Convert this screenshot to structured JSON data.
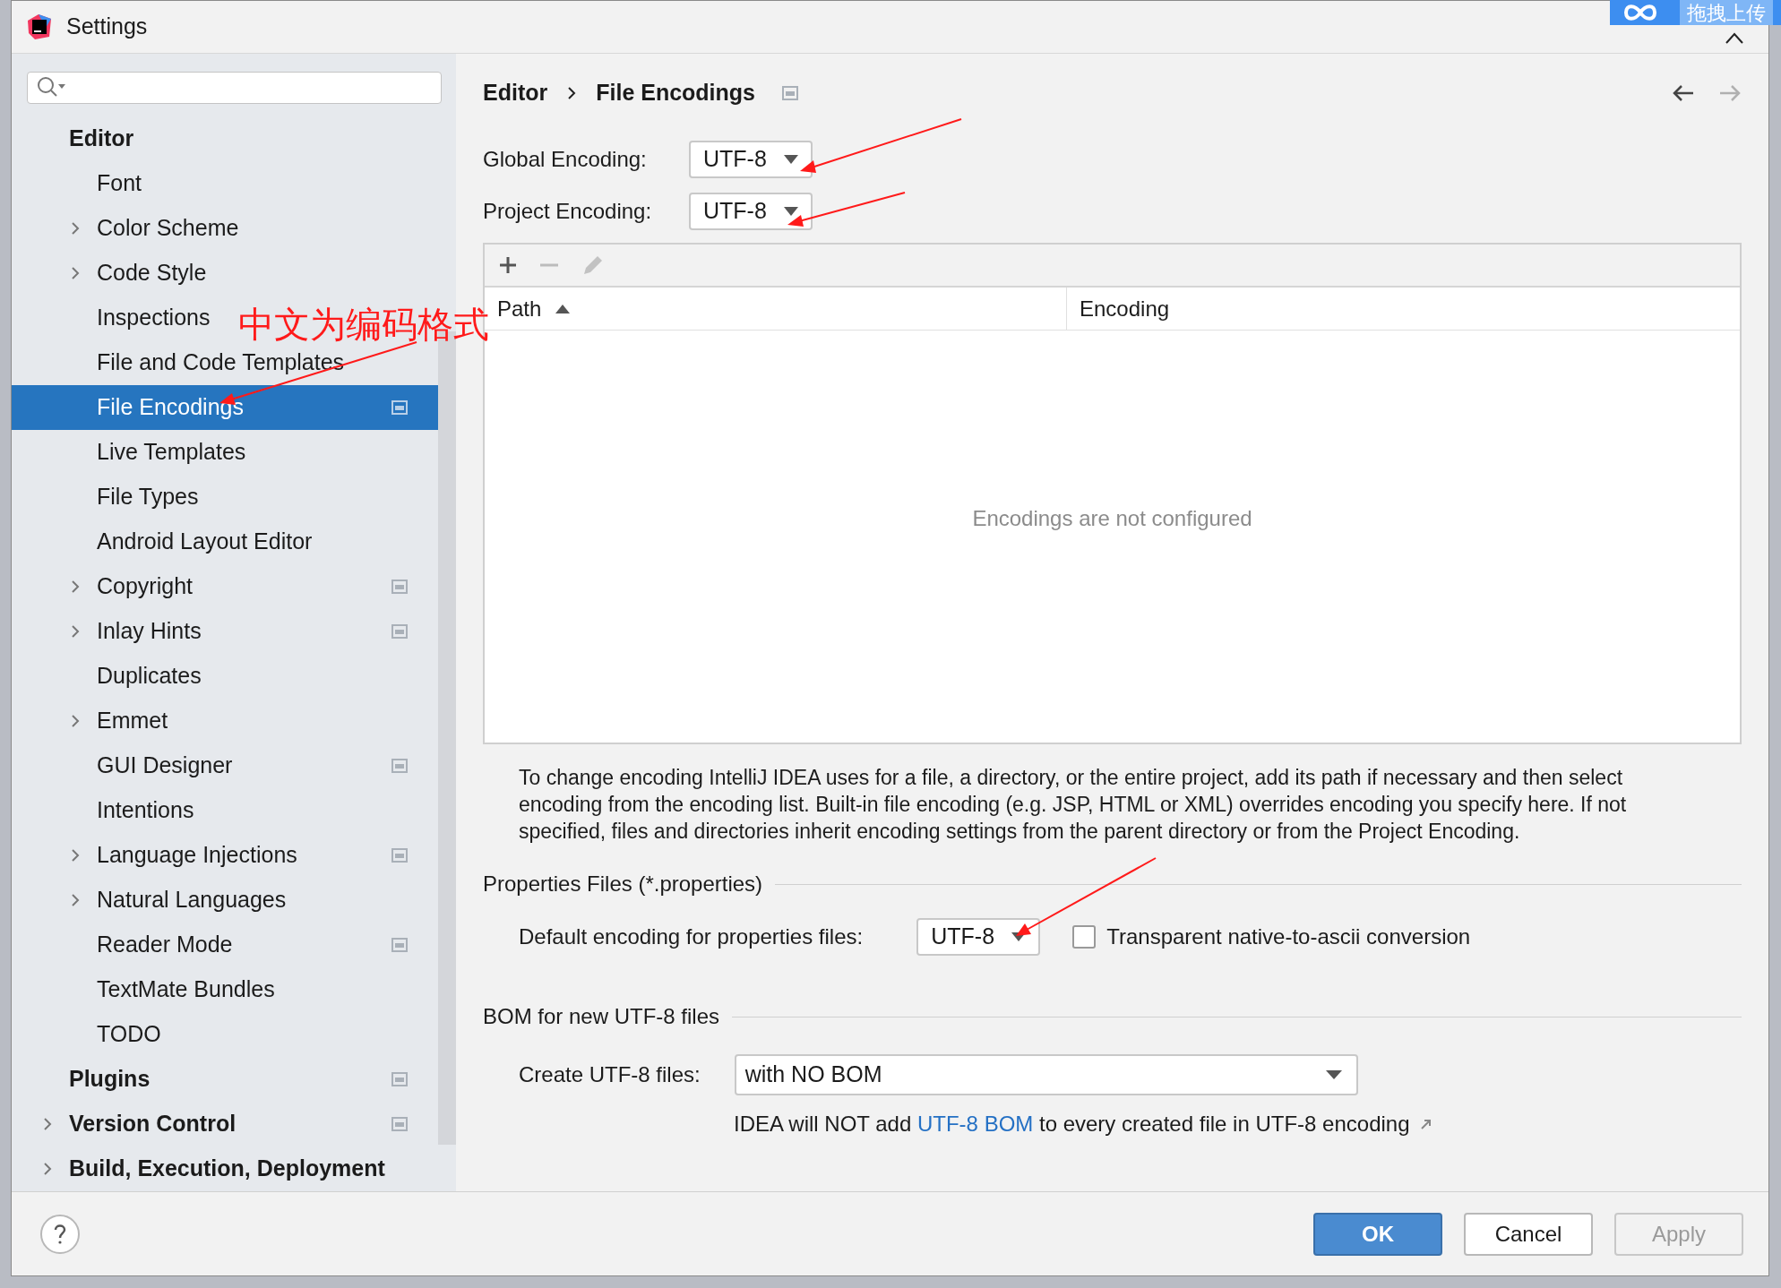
{
  "window": {
    "title": "Settings"
  },
  "upload_tab": {
    "label": "拖拽上传"
  },
  "tree": [
    {
      "label": "Editor",
      "collapsed": false,
      "selected": false,
      "project_icon": false,
      "children": [
        {
          "label": "Font",
          "collapsed": false,
          "selected": false,
          "project_icon": false
        },
        {
          "label": "Color Scheme",
          "collapsed": true,
          "selected": false,
          "project_icon": false
        },
        {
          "label": "Code Style",
          "collapsed": true,
          "selected": false,
          "project_icon": false
        },
        {
          "label": "Inspections",
          "collapsed": false,
          "selected": false,
          "project_icon": false
        },
        {
          "label": "File and Code Templates",
          "collapsed": false,
          "selected": false,
          "project_icon": false
        },
        {
          "label": "File Encodings",
          "collapsed": false,
          "selected": true,
          "project_icon": true
        },
        {
          "label": "Live Templates",
          "collapsed": false,
          "selected": false,
          "project_icon": false
        },
        {
          "label": "File Types",
          "collapsed": false,
          "selected": false,
          "project_icon": false
        },
        {
          "label": "Android Layout Editor",
          "collapsed": false,
          "selected": false,
          "project_icon": false
        },
        {
          "label": "Copyright",
          "collapsed": true,
          "selected": false,
          "project_icon": true
        },
        {
          "label": "Inlay Hints",
          "collapsed": true,
          "selected": false,
          "project_icon": true
        },
        {
          "label": "Duplicates",
          "collapsed": false,
          "selected": false,
          "project_icon": false
        },
        {
          "label": "Emmet",
          "collapsed": true,
          "selected": false,
          "project_icon": false
        },
        {
          "label": "GUI Designer",
          "collapsed": false,
          "selected": false,
          "project_icon": true
        },
        {
          "label": "Intentions",
          "collapsed": false,
          "selected": false,
          "project_icon": false
        },
        {
          "label": "Language Injections",
          "collapsed": true,
          "selected": false,
          "project_icon": true
        },
        {
          "label": "Natural Languages",
          "collapsed": true,
          "selected": false,
          "project_icon": false
        },
        {
          "label": "Reader Mode",
          "collapsed": false,
          "selected": false,
          "project_icon": true
        },
        {
          "label": "TextMate Bundles",
          "collapsed": false,
          "selected": false,
          "project_icon": false
        },
        {
          "label": "TODO",
          "collapsed": false,
          "selected": false,
          "project_icon": false
        }
      ]
    },
    {
      "label": "Plugins",
      "collapsed": false,
      "selected": false,
      "project_icon": true
    },
    {
      "label": "Version Control",
      "collapsed": true,
      "selected": false,
      "project_icon": true
    },
    {
      "label": "Build, Execution, Deployment",
      "collapsed": true,
      "selected": false,
      "project_icon": false
    }
  ],
  "breadcrumb": [
    "Editor",
    "File Encodings"
  ],
  "global_encoding": {
    "label": "Global Encoding:",
    "value": "UTF-8"
  },
  "project_encoding": {
    "label": "Project Encoding:",
    "value": "UTF-8"
  },
  "table": {
    "columns": [
      {
        "label": "Path",
        "sorted": true
      },
      {
        "label": "Encoding",
        "sorted": false
      }
    ],
    "empty_text": "Encodings are not configured"
  },
  "description": "To change encoding IntelliJ IDEA uses for a file, a directory, or the entire project, add its path if necessary and then select encoding from the encoding list. Built-in file encoding (e.g. JSP, HTML or XML) overrides encoding you specify here. If not specified, files and directories inherit encoding settings from the parent directory or from the Project Encoding.",
  "properties": {
    "title": "Properties Files (*.properties)",
    "label": "Default encoding for properties files:",
    "value": "UTF-8",
    "checkbox": {
      "label": "Transparent native-to-ascii conversion",
      "checked": false
    }
  },
  "bom": {
    "title": "BOM for new UTF-8 files",
    "label": "Create UTF-8 files:",
    "value": "with NO BOM",
    "note_before": "IDEA will NOT add",
    "note_link": "UTF-8 BOM",
    "note_after": "to every created file in UTF-8 encoding"
  },
  "annotation": "中文为编码格式",
  "buttons": [
    {
      "label": "OK",
      "kind": "primary"
    },
    {
      "label": "Cancel",
      "kind": "normal"
    },
    {
      "label": "Apply",
      "kind": "disabled"
    }
  ]
}
